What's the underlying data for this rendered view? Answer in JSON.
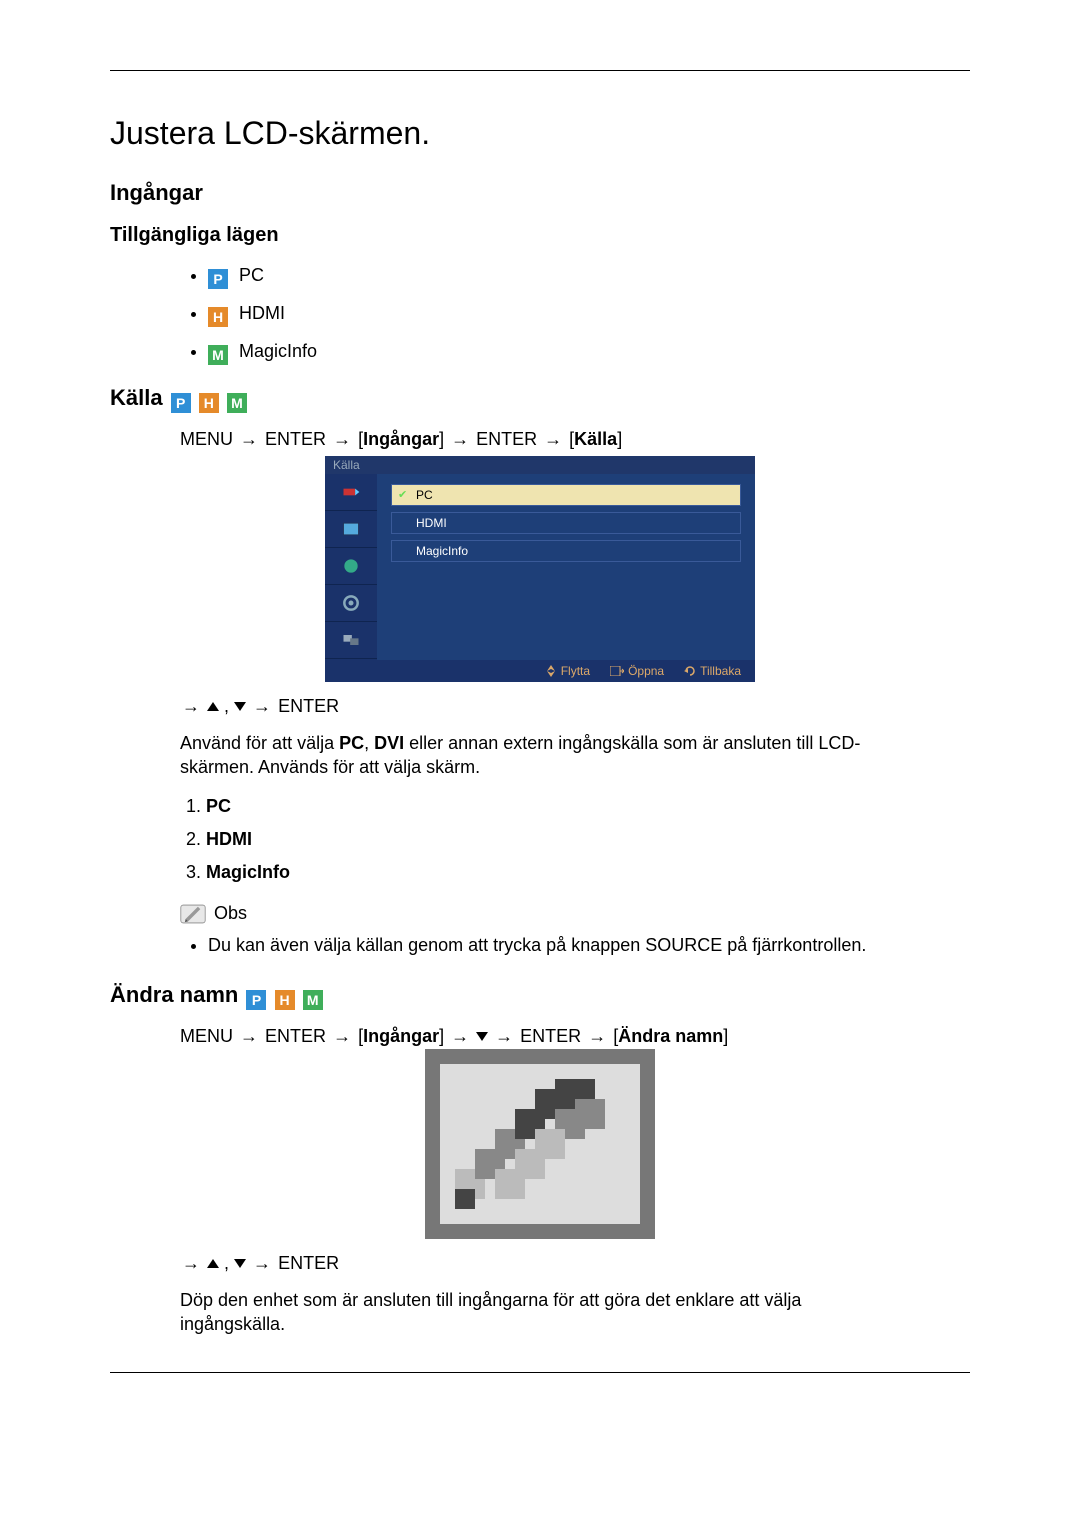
{
  "title": "Justera LCD-skärmen.",
  "section_inputs": "Ingångar",
  "subsection_modes": "Tillgängliga lägen",
  "modes": {
    "pc": "PC",
    "hdmi": "HDMI",
    "magicinfo": "MagicInfo"
  },
  "source_heading": "Källa",
  "path1": {
    "menu": "MENU",
    "enter": "ENTER",
    "ingangar": "Ingångar",
    "kalla": "Källa"
  },
  "osd": {
    "title": "Källa",
    "rows": {
      "pc": "PC",
      "hdmi": "HDMI",
      "magicinfo": "MagicInfo"
    },
    "foot": {
      "move": "Flytta",
      "open": "Öppna",
      "back": "Tillbaka"
    }
  },
  "nav_enter": "ENTER",
  "body1_a": "Använd för att välja ",
  "body1_pc": "PC",
  "body1_b": ", ",
  "body1_dvi": "DVI",
  "body1_c": " eller annan extern ingångskälla som är ansluten till LCD-skärmen. Används för att välja skärm.",
  "numlist": {
    "pc": "PC",
    "hdmi": "HDMI",
    "magicinfo": "MagicInfo"
  },
  "note_label": "Obs",
  "note_text": "Du kan även välja källan genom att trycka på knappen SOURCE på fjärrkontrollen.",
  "rename_heading": "Ändra namn",
  "path2": {
    "menu": "MENU",
    "enter": "ENTER",
    "ingangar": "Ingångar",
    "andra": "Ändra namn"
  },
  "body2": "Döp den enhet som är ansluten till ingångarna för att göra det enklare att välja ingångskälla."
}
